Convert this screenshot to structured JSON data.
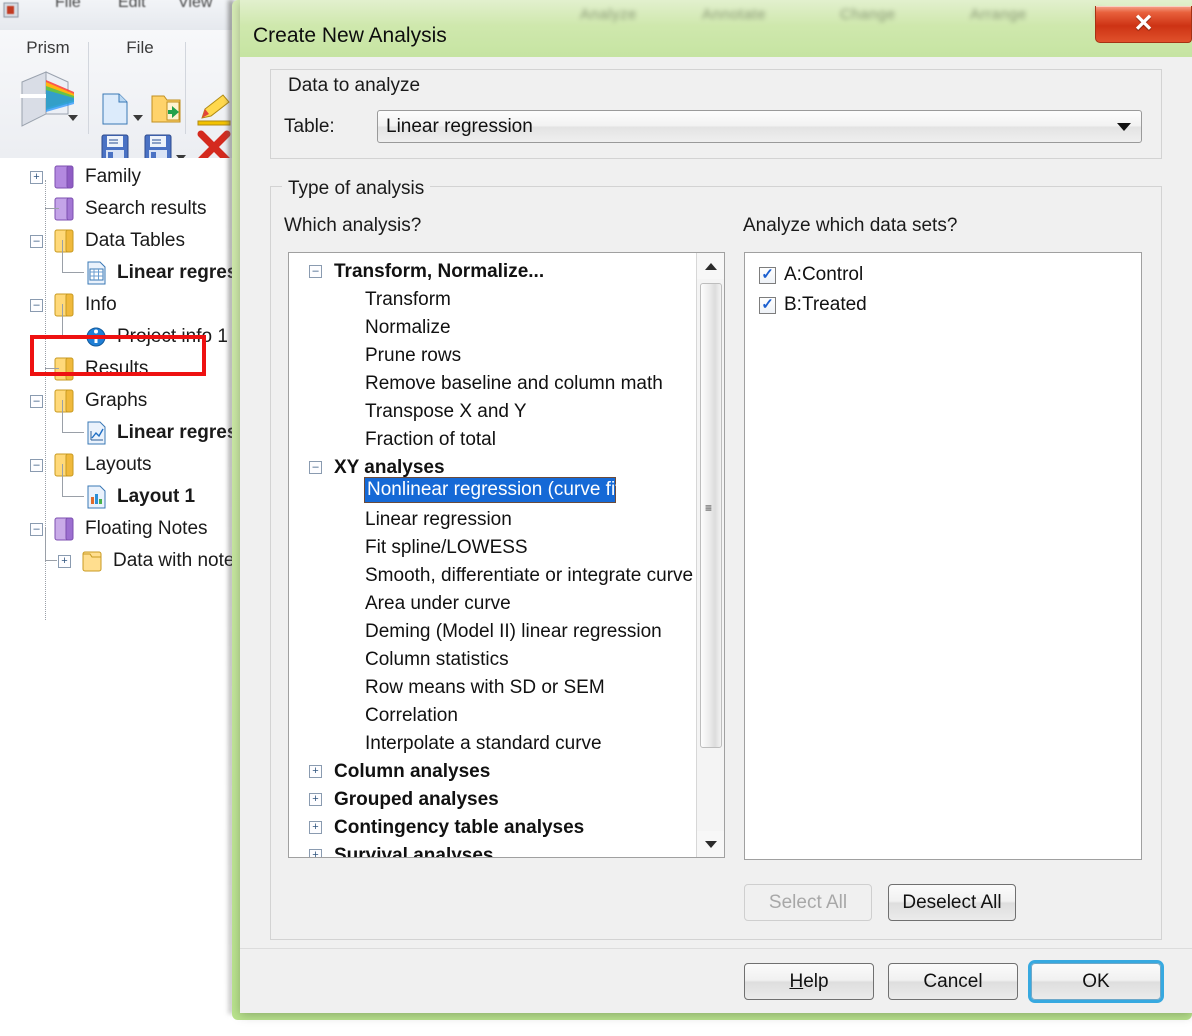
{
  "background_app": {
    "menu_items": [
      "File",
      "Edit",
      "View"
    ],
    "ribbon": {
      "groups": [
        {
          "label": "Prism",
          "icons": [
            "prism-cube-icon",
            "dropdown-caret-icon"
          ]
        },
        {
          "label": "File",
          "icons": [
            "new-file-icon",
            "open-folder-icon",
            "save-icon",
            "save-as-icon"
          ]
        },
        {
          "label": "",
          "icons": [
            "pencil-icon",
            "delete-x-icon"
          ]
        }
      ]
    },
    "navigator": {
      "items": [
        {
          "label": "Family",
          "icon": "purple-book-icon",
          "expander": "+",
          "indent": 0,
          "bold": false
        },
        {
          "label": "Search results",
          "icon": "purple-book-icon",
          "expander": "",
          "indent": 0,
          "bold": false
        },
        {
          "label": "Data Tables",
          "icon": "yellow-folder-icon",
          "expander": "-",
          "indent": 0,
          "bold": false
        },
        {
          "label": "Linear regress",
          "icon": "data-table-icon",
          "expander": "",
          "indent": 1,
          "bold": true
        },
        {
          "label": "Info",
          "icon": "yellow-folder-icon",
          "expander": "-",
          "indent": 0,
          "bold": false
        },
        {
          "label": "Project info 1",
          "icon": "info-circle-icon",
          "expander": "",
          "indent": 1,
          "bold": false
        },
        {
          "label": "Results",
          "icon": "yellow-folder-icon",
          "expander": "",
          "indent": 0,
          "bold": false
        },
        {
          "label": "Graphs",
          "icon": "yellow-folder-icon",
          "expander": "-",
          "indent": 0,
          "bold": false
        },
        {
          "label": "Linear regress",
          "icon": "graph-icon",
          "expander": "",
          "indent": 1,
          "bold": true
        },
        {
          "label": "Layouts",
          "icon": "yellow-folder-icon",
          "expander": "-",
          "indent": 0,
          "bold": false
        },
        {
          "label": "Layout 1",
          "icon": "layout-icon",
          "expander": "",
          "indent": 1,
          "bold": true
        },
        {
          "label": "Floating Notes",
          "icon": "purple-book-icon",
          "expander": "-",
          "indent": 0,
          "bold": false
        },
        {
          "label": "Data with note",
          "icon": "yellow-folder-icon",
          "expander": "+",
          "indent": 1,
          "bold": false
        }
      ],
      "highlight": {
        "target": "Results",
        "color": "#ee1111"
      }
    }
  },
  "dialog": {
    "title": "Create New Analysis",
    "close_label": "✕",
    "data_to_analyze": {
      "legend": "Data to analyze",
      "table_label": "Table:",
      "table_value": "Linear regression"
    },
    "type_of_analysis": {
      "legend": "Type of analysis",
      "which_analysis_label": "Which analysis?",
      "datasets_label": "Analyze which data sets?",
      "tree": [
        {
          "label": "Transform, Normalize...",
          "type": "category",
          "expander": "-"
        },
        {
          "label": "Transform",
          "type": "item"
        },
        {
          "label": "Normalize",
          "type": "item"
        },
        {
          "label": "Prune rows",
          "type": "item"
        },
        {
          "label": "Remove baseline and column math",
          "type": "item"
        },
        {
          "label": "Transpose X and Y",
          "type": "item"
        },
        {
          "label": "Fraction of total",
          "type": "item"
        },
        {
          "label": "XY analyses",
          "type": "category",
          "expander": "-"
        },
        {
          "label": "Nonlinear regression (curve fit)",
          "type": "item",
          "selected": true
        },
        {
          "label": "Linear regression",
          "type": "item"
        },
        {
          "label": "Fit spline/LOWESS",
          "type": "item"
        },
        {
          "label": "Smooth, differentiate or integrate curve",
          "type": "item"
        },
        {
          "label": "Area under curve",
          "type": "item"
        },
        {
          "label": "Deming (Model II) linear regression",
          "type": "item"
        },
        {
          "label": "Column statistics",
          "type": "item"
        },
        {
          "label": "Row means with SD or SEM",
          "type": "item"
        },
        {
          "label": "Correlation",
          "type": "item"
        },
        {
          "label": "Interpolate a standard curve",
          "type": "item"
        },
        {
          "label": "Column analyses",
          "type": "category",
          "expander": "+"
        },
        {
          "label": "Grouped analyses",
          "type": "category",
          "expander": "+"
        },
        {
          "label": "Contingency table analyses",
          "type": "category",
          "expander": "+"
        },
        {
          "label": "Survival analyses",
          "type": "category",
          "expander": "+"
        }
      ],
      "datasets": [
        {
          "label": "A:Control",
          "checked": true
        },
        {
          "label": "B:Treated",
          "checked": true
        }
      ],
      "select_all": "Select All",
      "deselect_all": "Deselect All"
    },
    "footer": {
      "help": "Help",
      "help_mnemonic": "H",
      "cancel": "Cancel",
      "ok": "OK"
    },
    "colors": {
      "titlebar": "#cfe8ad",
      "close_button": "#cd3314",
      "selection": "#1569d6",
      "focus_ring": "#37a9e0",
      "highlight_box": "#ee1111"
    }
  }
}
